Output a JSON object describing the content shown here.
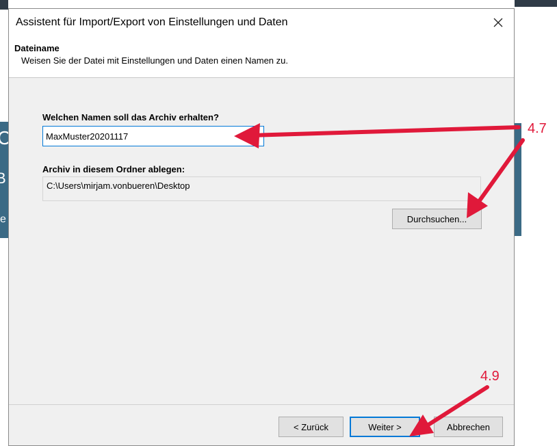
{
  "dialog": {
    "title": "Assistent für Import/Export von Einstellungen und Daten",
    "close_icon": "close-icon"
  },
  "header": {
    "title": "Dateiname",
    "subtitle": "Weisen Sie der Datei mit Einstellungen und Daten einen Namen zu."
  },
  "form": {
    "name_label": "Welchen Namen soll das Archiv erhalten?",
    "name_value": "MaxMuster20201117",
    "folder_label": "Archiv in diesem Ordner ablegen:",
    "folder_value": "C:\\Users\\mirjam.vonbueren\\Desktop",
    "browse_label": "Durchsuchen..."
  },
  "footer": {
    "back_label": "< Zurück",
    "next_label": "Weiter >",
    "cancel_label": "Abbrechen"
  },
  "annotations": {
    "step_a": "4.7",
    "step_b": "4.9",
    "color": "#e0193a"
  },
  "background": {
    "left_letter_1": "C",
    "left_letter_2": "B",
    "left_letter_3": "e"
  }
}
